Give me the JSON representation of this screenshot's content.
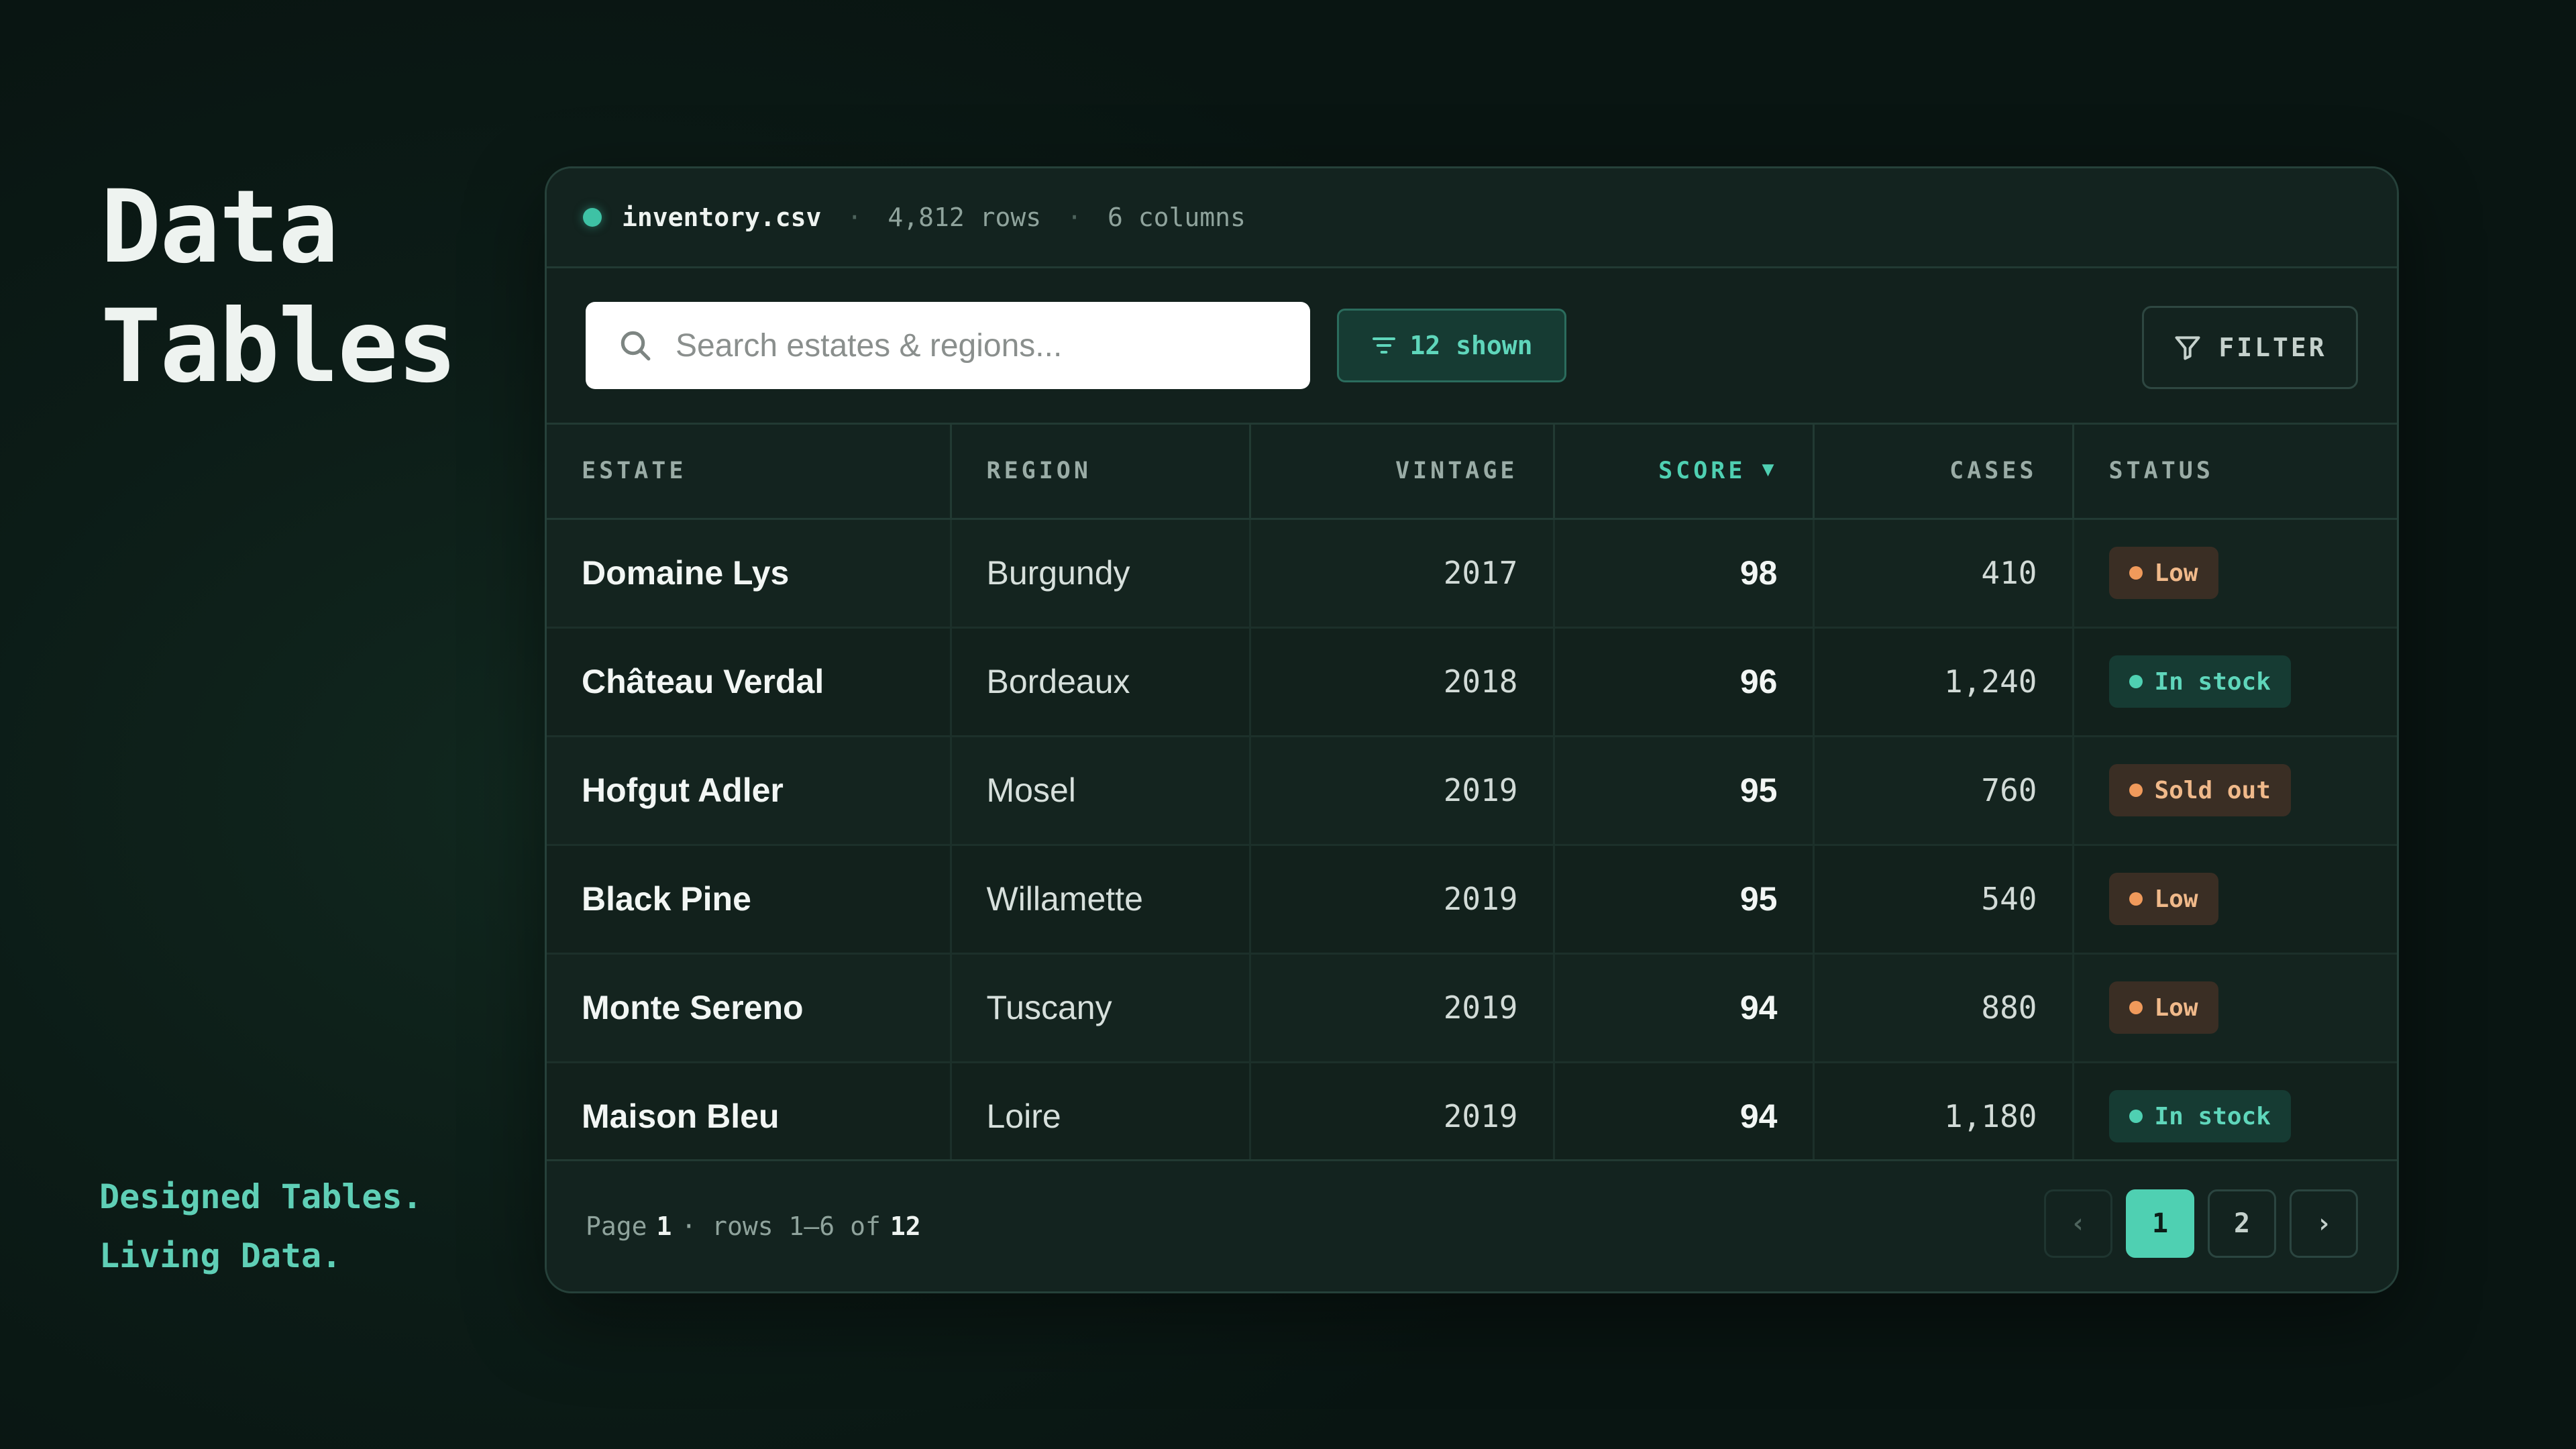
{
  "hero": {
    "title_line1": "Data",
    "title_line2": "Tables"
  },
  "tagline": {
    "line1": "Designed Tables.",
    "line2": "Living Data."
  },
  "file_bar": {
    "name": "inventory.csv",
    "rows": "4,812 rows",
    "columns": "6 columns",
    "separator": "·",
    "status_color": "#3ec2a5"
  },
  "toolbar": {
    "search_placeholder": "Search estates & regions...",
    "shown_label": "12 shown",
    "filter_label": "FILTER"
  },
  "table": {
    "columns": [
      "ESTATE",
      "REGION",
      "VINTAGE",
      "SCORE",
      "CASES",
      "STATUS"
    ],
    "sort": {
      "column": "SCORE",
      "direction": "desc",
      "arrow": "▼"
    },
    "rows": [
      {
        "estate": "Domaine Lys",
        "region": "Burgundy",
        "vintage": "2017",
        "score": "98",
        "cases": "410",
        "status": "Low",
        "status_kind": "warn"
      },
      {
        "estate": "Château Verdal",
        "region": "Bordeaux",
        "vintage": "2018",
        "score": "96",
        "cases": "1,240",
        "status": "In stock",
        "status_kind": "ok"
      },
      {
        "estate": "Hofgut Adler",
        "region": "Mosel",
        "vintage": "2019",
        "score": "95",
        "cases": "760",
        "status": "Sold out",
        "status_kind": "warn"
      },
      {
        "estate": "Black Pine",
        "region": "Willamette",
        "vintage": "2019",
        "score": "95",
        "cases": "540",
        "status": "Low",
        "status_kind": "warn"
      },
      {
        "estate": "Monte Sereno",
        "region": "Tuscany",
        "vintage": "2019",
        "score": "94",
        "cases": "880",
        "status": "Low",
        "status_kind": "warn"
      },
      {
        "estate": "Maison Bleu",
        "region": "Loire",
        "vintage": "2019",
        "score": "94",
        "cases": "1,180",
        "status": "In stock",
        "status_kind": "ok"
      }
    ]
  },
  "footer": {
    "page_prefix": "Page",
    "page": "1",
    "rows_text": "· rows 1–6 of",
    "total": "12",
    "pager": {
      "prev": "‹",
      "pages": [
        "1",
        "2"
      ],
      "active": "1",
      "next": "›"
    }
  },
  "colors": {
    "accent": "#4fd0b2",
    "warn": "#f09a5b",
    "background": "#0c1c17"
  }
}
